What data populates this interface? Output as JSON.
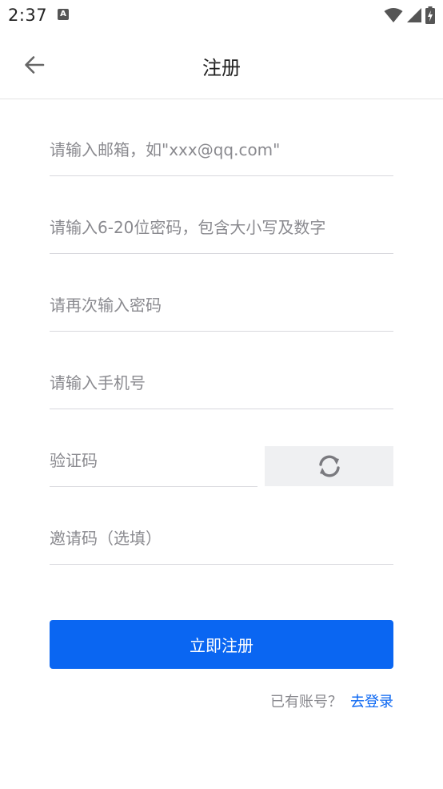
{
  "status_bar": {
    "time": "2:37",
    "notification_glyph": "A",
    "icons": [
      "wifi-icon",
      "signal-icon",
      "battery-charging-icon"
    ]
  },
  "app_bar": {
    "title": "注册",
    "back_icon": "arrow-left-icon"
  },
  "form": {
    "email_placeholder": "请输入邮箱，如\"xxx@qq.com\"",
    "password_placeholder": "请输入6-20位密码，包含大小写及数字",
    "confirm_password_placeholder": "请再次输入密码",
    "phone_placeholder": "请输入手机号",
    "captcha_placeholder": "验证码",
    "captcha_refresh_icon": "refresh-icon",
    "invite_code_placeholder": "邀请码（选填）",
    "submit_label": "立即注册"
  },
  "footer": {
    "login_prompt": "已有账号？",
    "login_link": "去登录"
  },
  "colors": {
    "primary": "#0a66f2",
    "placeholder": "#8a8a8f",
    "divider": "#d8d8dd",
    "captcha_bg": "#eff0f2"
  }
}
